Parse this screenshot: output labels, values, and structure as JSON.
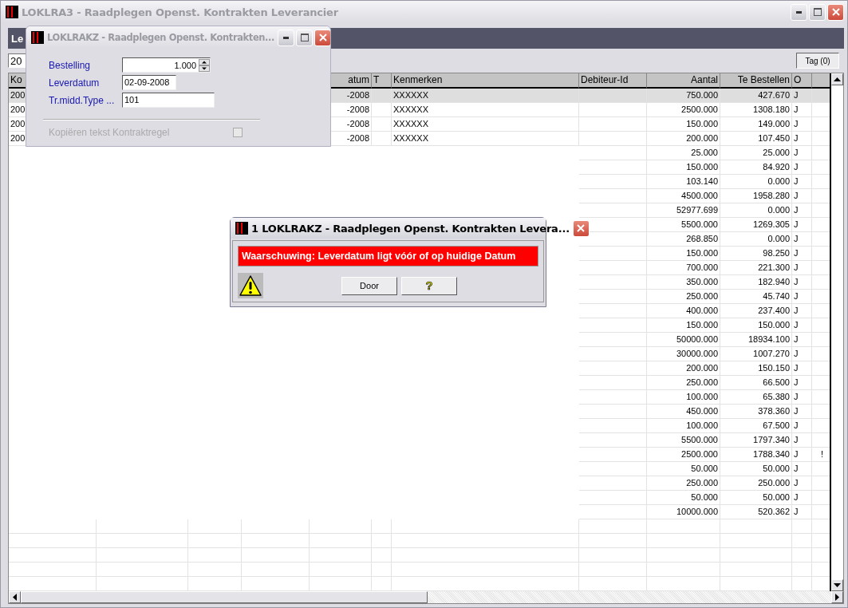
{
  "main_window": {
    "title": "LOKLRA3 - Raadplegen Openst. Kontrakten Leverancier"
  },
  "header_bar": {
    "label": "Le"
  },
  "filter_field": {
    "value": "20"
  },
  "tag_button": {
    "label": "Tag (0)"
  },
  "table": {
    "columns": [
      {
        "label": "Ko"
      },
      {},
      {},
      {},
      {
        "label": "atum"
      },
      {
        "label": "T"
      },
      {
        "label": "Kenmerken"
      },
      {
        "label": "Debiteur-Id"
      },
      {
        "label": "Aantal"
      },
      {
        "label": "Te Bestellen"
      },
      {
        "label": "O"
      },
      {}
    ],
    "rows": [
      {
        "selected": true,
        "column_1": "200",
        "datum": "-2008",
        "kenmerken": "XXXXXX",
        "aantal": "750.000",
        "te_bestellen": "427.670",
        "o": "J"
      },
      {
        "selected": false,
        "column_1": "200",
        "datum": "-2008",
        "kenmerken": "XXXXXX",
        "aantal": "2500.000",
        "te_bestellen": "1308.180",
        "o": "J"
      },
      {
        "selected": false,
        "column_1": "200",
        "datum": "-2008",
        "kenmerken": "XXXXXX",
        "aantal": "150.000",
        "te_bestellen": "149.000",
        "o": "J"
      },
      {
        "selected": false,
        "column_1": "200",
        "datum": "-2008",
        "kenmerken": "XXXXXX",
        "aantal": "200.000",
        "te_bestellen": "107.450",
        "o": "J"
      },
      {
        "selected": false,
        "aantal": "25.000",
        "te_bestellen": "25.000",
        "o": "J"
      },
      {
        "selected": false,
        "aantal": "150.000",
        "te_bestellen": "84.920",
        "o": "J"
      },
      {
        "selected": false,
        "aantal": "103.140",
        "te_bestellen": "0.000",
        "o": "J"
      },
      {
        "selected": false,
        "aantal": "4500.000",
        "te_bestellen": "1958.280",
        "o": "J"
      },
      {
        "selected": false,
        "aantal": "52977.699",
        "te_bestellen": "0.000",
        "o": "J"
      },
      {
        "selected": false,
        "aantal": "5500.000",
        "te_bestellen": "1269.305",
        "o": "J"
      },
      {
        "selected": false,
        "aantal": "268.850",
        "te_bestellen": "0.000",
        "o": "J"
      },
      {
        "selected": false,
        "aantal": "150.000",
        "te_bestellen": "98.250",
        "o": "J"
      },
      {
        "selected": false,
        "aantal": "700.000",
        "te_bestellen": "221.300",
        "o": "J"
      },
      {
        "selected": false,
        "aantal": "350.000",
        "te_bestellen": "182.940",
        "o": "J"
      },
      {
        "selected": false,
        "aantal": "250.000",
        "te_bestellen": "45.740",
        "o": "J"
      },
      {
        "selected": false,
        "aantal": "400.000",
        "te_bestellen": "237.400",
        "o": "J"
      },
      {
        "selected": false,
        "aantal": "150.000",
        "te_bestellen": "150.000",
        "o": "J"
      },
      {
        "selected": false,
        "aantal": "50000.000",
        "te_bestellen": "18934.100",
        "o": "J"
      },
      {
        "selected": false,
        "aantal": "30000.000",
        "te_bestellen": "1007.270",
        "o": "J"
      },
      {
        "selected": false,
        "aantal": "200.000",
        "te_bestellen": "150.150",
        "o": "J"
      },
      {
        "selected": false,
        "aantal": "250.000",
        "te_bestellen": "66.500",
        "o": "J"
      },
      {
        "selected": false,
        "aantal": "100.000",
        "te_bestellen": "65.380",
        "o": "J"
      },
      {
        "selected": false,
        "aantal": "450.000",
        "te_bestellen": "378.360",
        "o": "J"
      },
      {
        "selected": false,
        "aantal": "100.000",
        "te_bestellen": "67.500",
        "o": "J"
      },
      {
        "selected": false,
        "aantal": "5500.000",
        "te_bestellen": "1797.340",
        "o": "J"
      },
      {
        "selected": false,
        "aantal": "2500.000",
        "te_bestellen": "1788.340",
        "o": "J",
        "column_12": "!"
      },
      {
        "selected": false,
        "aantal": "50.000",
        "te_bestellen": "50.000",
        "o": "J"
      },
      {
        "selected": false,
        "aantal": "250.000",
        "te_bestellen": "250.000",
        "o": "J"
      },
      {
        "selected": false,
        "aantal": "50.000",
        "te_bestellen": "50.000",
        "o": "J"
      },
      {
        "selected": false,
        "aantal": "10000.000",
        "te_bestellen": "520.362",
        "o": "J"
      }
    ]
  },
  "sub_window": {
    "title": "LOKLRAKZ - Raadplegen Openst. Kontrakten...",
    "fields": [
      {
        "kind": "spinner",
        "label": "Bestelling",
        "value": "1.000"
      },
      {
        "kind": "text",
        "label": "Leverdatum",
        "value": "02-09-2008"
      },
      {
        "kind": "text",
        "label": "Tr.midd.Type ...",
        "value": "101"
      }
    ],
    "checkbox": {
      "label": "Kopiëren tekst Kontraktregel",
      "checked": false,
      "disabled": true
    }
  },
  "dialog": {
    "title": "1 LOKLRAKZ - Raadplegen Openst. Kontrakten Levera...",
    "message": "Waarschuwing: Leverdatum ligt vóór of op huidige Datum",
    "buttons": [
      {
        "kind": "text",
        "label": "Door"
      },
      {
        "kind": "help",
        "label": "?"
      }
    ]
  }
}
